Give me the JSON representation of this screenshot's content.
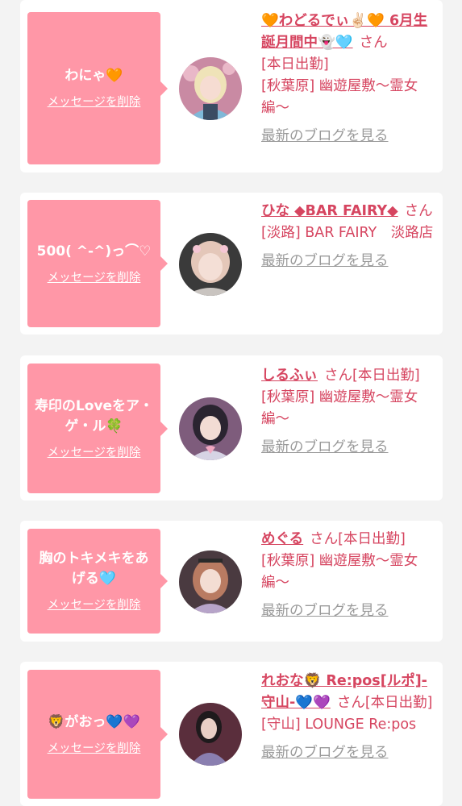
{
  "colors": {
    "background": "#f3f3f3",
    "card": "#ffffff",
    "bubble": "#ff97a7",
    "accent_text": "#d64560",
    "link_gray": "#9a9a9a"
  },
  "messages": [
    {
      "message": "わにゃ🧡",
      "delete_label": "メッセージを削除",
      "name": "🧡わどるでぃ✌🏻🧡 6月生誕月間中👻🩵",
      "honorific": "さん",
      "status": "[本日出勤]",
      "shop": "[秋葉原] 幽遊屋敷〜霊女編〜",
      "blog_label": "最新のブログを見る",
      "avatar_icon": "girl-portrait-blonde"
    },
    {
      "message": "500( ^-^)っ⌒♡",
      "delete_label": "メッセージを削除",
      "name": "ひな ◆BAR FAIRY◆",
      "honorific": "さん",
      "status": "",
      "shop": "[淡路] BAR FAIRY　淡路店",
      "blog_label": "最新のブログを見る",
      "avatar_icon": "girl-portrait-pink-hair"
    },
    {
      "message": "寿印のLoveをア・ゲ・ル🍀",
      "delete_label": "メッセージを削除",
      "name": "しるふぃ",
      "honorific": "さん",
      "status": "[本日出勤]",
      "shop": "[秋葉原] 幽遊屋敷〜霊女編〜",
      "blog_label": "最新のブログを見る",
      "avatar_icon": "girl-portrait-dark-hair"
    },
    {
      "message": "胸のトキメキをあげる🩵",
      "delete_label": "メッセージを削除",
      "name": "めぐる",
      "honorific": "さん",
      "status": "[本日出勤]",
      "shop": "[秋葉原] 幽遊屋敷〜霊女編〜",
      "blog_label": "最新のブログを見る",
      "avatar_icon": "girl-portrait-auburn-hair"
    },
    {
      "message": "🦁がおっ💙💜",
      "delete_label": "メッセージを削除",
      "name": "れおな🦁 Re:pos[ルポ]-守山-💙💜",
      "honorific": "さん",
      "status": "[本日出勤]",
      "shop": "[守山] LOUNGE Re:pos",
      "blog_label": "最新のブログを見る",
      "avatar_icon": "girl-portrait-black-hair"
    }
  ]
}
